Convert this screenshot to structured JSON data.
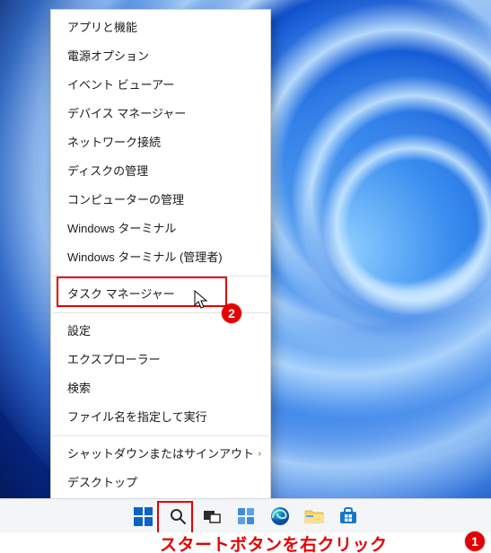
{
  "menu": {
    "items": [
      {
        "label": "アプリと機能"
      },
      {
        "label": "電源オプション"
      },
      {
        "label": "イベント ビューアー"
      },
      {
        "label": "デバイス マネージャー"
      },
      {
        "label": "ネットワーク接続"
      },
      {
        "label": "ディスクの管理"
      },
      {
        "label": "コンピューターの管理"
      },
      {
        "label": "Windows ターミナル"
      },
      {
        "label": "Windows ターミナル (管理者)"
      }
    ],
    "items2": [
      {
        "label": "タスク マネージャー"
      }
    ],
    "items3": [
      {
        "label": "設定"
      },
      {
        "label": "エクスプローラー"
      },
      {
        "label": "検索"
      },
      {
        "label": "ファイル名を指定して実行"
      }
    ],
    "items4": [
      {
        "label": "シャットダウンまたはサインアウト",
        "submenu": true
      },
      {
        "label": "デスクトップ"
      }
    ]
  },
  "callouts": {
    "badge1": "1",
    "badge2": "2",
    "caption": "スタートボタンを右クリック"
  },
  "submenu_glyph": "›"
}
